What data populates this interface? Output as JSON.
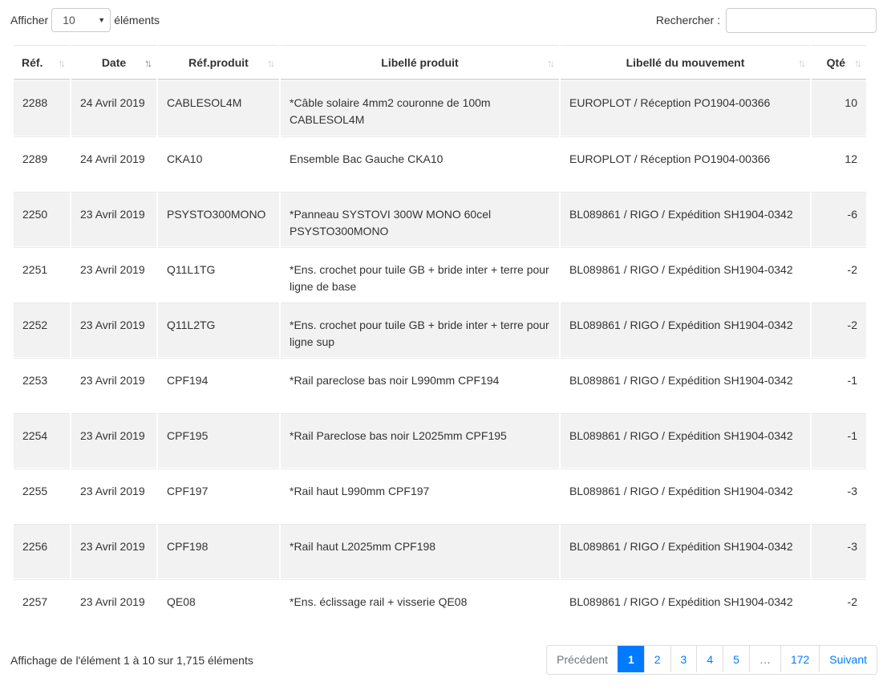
{
  "length": {
    "prefix": "Afficher",
    "value": "10",
    "suffix": "éléments"
  },
  "search": {
    "label": "Rechercher :",
    "value": ""
  },
  "columns": [
    "Réf.",
    "Date",
    "Réf.produit",
    "Libellé produit",
    "Libellé du mouvement",
    "Qté"
  ],
  "rows": [
    {
      "ref": "2288",
      "date": "24 Avril 2019",
      "prod": "CABLESOL4M",
      "label": "*Câble solaire 4mm2 couronne de 100m CABLESOL4M",
      "move": "EUROPLOT / Réception PO1904-00366",
      "qty": "10"
    },
    {
      "ref": "2289",
      "date": "24 Avril 2019",
      "prod": "CKA10",
      "label": "Ensemble Bac Gauche CKA10",
      "move": "EUROPLOT / Réception PO1904-00366",
      "qty": "12"
    },
    {
      "ref": "2250",
      "date": "23 Avril 2019",
      "prod": "PSYSTO300MONO",
      "label": "*Panneau SYSTOVI 300W MONO 60cel PSYSTO300MONO",
      "move": "BL089861 / RIGO / Expédition SH1904-0342",
      "qty": "-6"
    },
    {
      "ref": "2251",
      "date": "23 Avril 2019",
      "prod": "Q11L1TG",
      "label": "*Ens. crochet pour tuile GB + bride inter + terre pour ligne de base",
      "move": "BL089861 / RIGO / Expédition SH1904-0342",
      "qty": "-2"
    },
    {
      "ref": "2252",
      "date": "23 Avril 2019",
      "prod": "Q11L2TG",
      "label": "*Ens. crochet pour tuile GB + bride inter + terre pour ligne sup",
      "move": "BL089861 / RIGO / Expédition SH1904-0342",
      "qty": "-2"
    },
    {
      "ref": "2253",
      "date": "23 Avril 2019",
      "prod": "CPF194",
      "label": "*Rail pareclose bas noir L990mm CPF194",
      "move": "BL089861 / RIGO / Expédition SH1904-0342",
      "qty": "-1"
    },
    {
      "ref": "2254",
      "date": "23 Avril 2019",
      "prod": "CPF195",
      "label": "*Rail Pareclose bas noir L2025mm CPF195",
      "move": "BL089861 / RIGO / Expédition SH1904-0342",
      "qty": "-1"
    },
    {
      "ref": "2255",
      "date": "23 Avril 2019",
      "prod": "CPF197",
      "label": "*Rail haut L990mm CPF197",
      "move": "BL089861 / RIGO / Expédition SH1904-0342",
      "qty": "-3"
    },
    {
      "ref": "2256",
      "date": "23 Avril 2019",
      "prod": "CPF198",
      "label": "*Rail haut L2025mm CPF198",
      "move": "BL089861 / RIGO / Expédition SH1904-0342",
      "qty": "-3"
    },
    {
      "ref": "2257",
      "date": "23 Avril 2019",
      "prod": "QE08",
      "label": "*Ens. éclissage rail + visserie QE08",
      "move": "BL089861 / RIGO / Expédition SH1904-0342",
      "qty": "-2"
    }
  ],
  "info": "Affichage de l'élément 1 à 10 sur 1,715 éléments",
  "pagination": {
    "previous": "Précédent",
    "pages": [
      "1",
      "2",
      "3",
      "4",
      "5"
    ],
    "ellipsis": "…",
    "last": "172",
    "next": "Suivant",
    "active": "1"
  },
  "colors": {
    "accent": "#007bff",
    "stripe": "#f2f2f2"
  },
  "icons": {
    "sort": "sort-arrows-icon",
    "select": "caret-down-icon"
  }
}
